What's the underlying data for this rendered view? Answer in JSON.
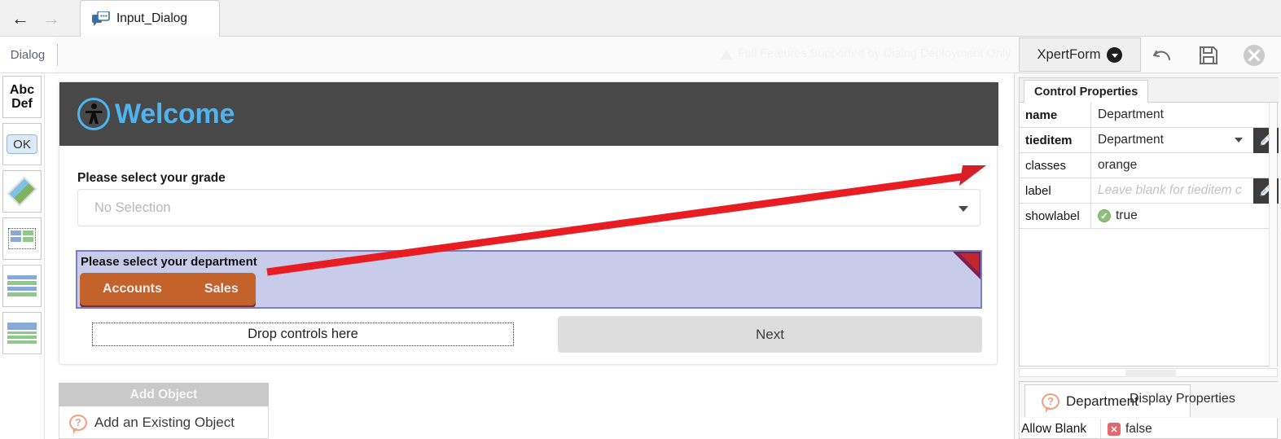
{
  "browser": {
    "tab_title": "Input_Dialog",
    "back_icon": "back-arrow-icon",
    "forward_icon": "forward-arrow-icon"
  },
  "toolbar": {
    "dialog_tab": "Dialog",
    "warning_text": "Full Features Supported by Dialog Deployment Only",
    "xpertform_label": "XpertForm",
    "undo_icon": "undo-icon",
    "save_icon": "save-floppy-icon",
    "close_icon": "close-circle-icon"
  },
  "palette": {
    "items": [
      {
        "name": "label-control",
        "line1": "Abc",
        "line2": "Def"
      },
      {
        "name": "button-control",
        "label": "OK"
      },
      {
        "name": "image-control",
        "label": ""
      },
      {
        "name": "two-column-layout",
        "label": ""
      },
      {
        "name": "rows-layout",
        "label": ""
      },
      {
        "name": "stacked-layout",
        "label": ""
      }
    ]
  },
  "form": {
    "title": "Welcome",
    "grade": {
      "label": "Please select your grade",
      "value": "No Selection"
    },
    "department": {
      "label": "Please select your department",
      "tabs": [
        "Accounts",
        "Sales"
      ]
    },
    "dropzone_text": "Drop controls here",
    "next_label": "Next"
  },
  "add_object": {
    "header": "Add Object",
    "item": "Add an Existing Object"
  },
  "control_properties": {
    "tab_label": "Control Properties",
    "rows": [
      {
        "key": "name",
        "value": "Department",
        "bold": true,
        "kind": "text"
      },
      {
        "key": "tieditem",
        "value": "Department",
        "bold": true,
        "kind": "select"
      },
      {
        "key": "classes",
        "value": "orange",
        "bold": false,
        "kind": "text"
      },
      {
        "key": "label",
        "value": "Leave blank for tieditem c",
        "bold": false,
        "kind": "placeholder"
      },
      {
        "key": "showlabel",
        "value": "true",
        "bold": false,
        "kind": "bool-true"
      }
    ]
  },
  "display_properties": {
    "tab_department": "Department",
    "tab_display": "Display Properties",
    "row_key": "Allow Blank",
    "row_value": "false"
  },
  "colors": {
    "accent_blue": "#4fb3f0",
    "header_dark": "#484848",
    "orange_tabs": "#c4622c",
    "panel_lavender": "#c8cbea",
    "annotation_red": "#e81d22"
  }
}
